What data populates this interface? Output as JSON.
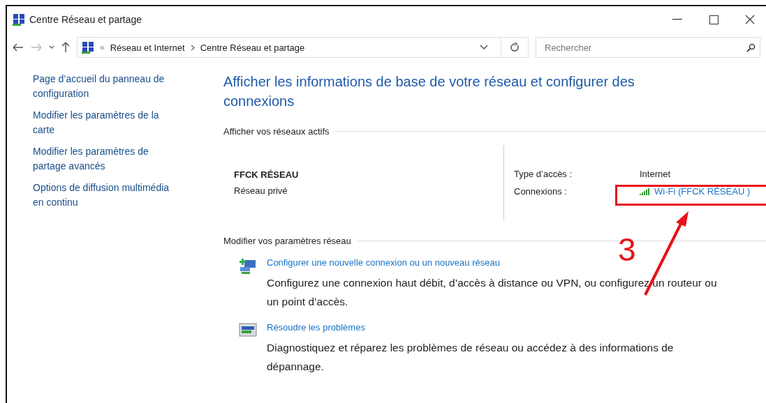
{
  "window": {
    "title": "Centre Réseau et partage"
  },
  "address_bar": {
    "separator": "«",
    "crumbs": [
      "Réseau et Internet",
      "Centre Réseau et partage"
    ]
  },
  "search": {
    "placeholder": "Rechercher"
  },
  "sidebar": {
    "items": [
      "Page d’accueil du panneau de configuration",
      "Modifier les paramètres de la carte",
      "Modifier les paramètres de partage avancés",
      "Options de diffusion multimédia en continu"
    ]
  },
  "heading": "Afficher les informations de base de votre réseau et configurer des connexions",
  "active_networks": {
    "title": "Afficher vos réseaux actifs",
    "name": "FFCK RÉSEAU",
    "category": "Réseau privé",
    "access_label": "Type d’accès :",
    "access_value": "Internet",
    "connections_label": "Connexions :",
    "connection_link": "Wi-Fi (FFCK RÉSEAU )"
  },
  "settings": {
    "title": "Modifier vos paramètres réseau",
    "tasks": [
      {
        "kind": "new-connection",
        "link": "Configurer une nouvelle connexion ou un nouveau réseau",
        "description": "Configurez une connexion haut débit, d’accès à distance ou VPN, ou configurez un routeur ou un point d’accès."
      },
      {
        "kind": "troubleshoot",
        "link": "Résoudre les problèmes",
        "description": "Diagnostiquez et réparez les problèmes de réseau ou accédez à des informations de dépannage."
      }
    ]
  },
  "annotation": {
    "number": "3"
  }
}
